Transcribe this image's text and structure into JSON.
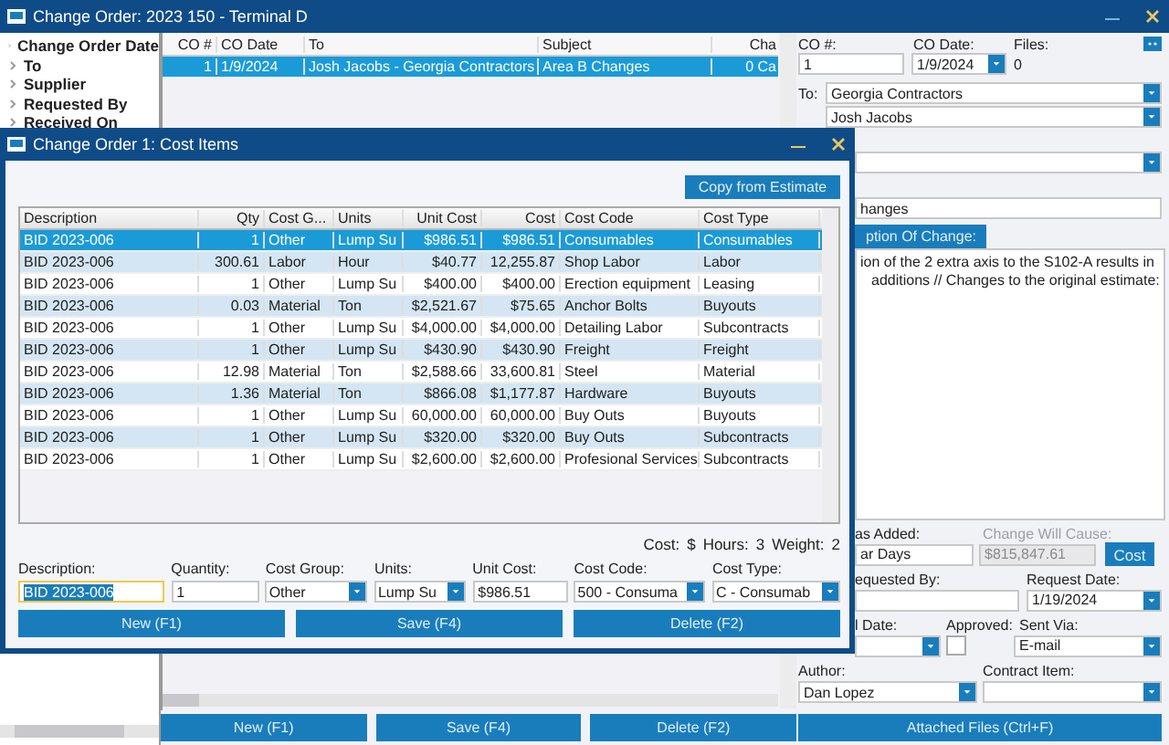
{
  "window": {
    "title": "Change Order: 2023 150 - Terminal D"
  },
  "tree": [
    "Change Order Date",
    "To",
    "Supplier",
    "Requested By",
    "Received On"
  ],
  "grid": {
    "columns": [
      {
        "label": "CO #",
        "numeric": true
      },
      {
        "label": "CO Date",
        "numeric": false
      },
      {
        "label": "To",
        "numeric": false
      },
      {
        "label": "Subject",
        "numeric": false
      },
      {
        "label": "Cha",
        "numeric": true
      }
    ],
    "rows": [
      {
        "selected": true,
        "cells": [
          "1",
          "1/9/2024",
          "Josh Jacobs - Georgia Contractors",
          "Area B Changes",
          "0 Ca"
        ]
      }
    ]
  },
  "buttons": [
    "New (F1)",
    "Save (F4)",
    "Delete (F2)"
  ],
  "form": {
    "co_number": {
      "label": "CO #:",
      "value": "1"
    },
    "co_date": {
      "label": "CO Date:",
      "value": "1/9/2024"
    },
    "files": {
      "label": "Files:",
      "value": "0"
    },
    "to": {
      "label": "To:",
      "company": "Georgia Contractors",
      "contact": "Josh Jacobs"
    },
    "subject_value": "hanges",
    "description_tab": "ption Of Change:",
    "description_lines": [
      "ion of the 2 extra axis to the S102-A results in",
      "additions // Changes to the original estimate:"
    ],
    "days_added": {
      "label": "as Added:",
      "value": "ar Days"
    },
    "change_will_cause": {
      "label": "Change Will Cause:",
      "value": "$815,847.61",
      "disabled": true
    },
    "cost_button": "Cost",
    "requested_by": {
      "label": "equested By:"
    },
    "request_date": {
      "label": "Request Date:",
      "value": "1/19/2024"
    },
    "date_label": "l Date:",
    "approved": {
      "label": "Approved:",
      "checked": false
    },
    "sent_via": {
      "label": "Sent Via:",
      "value": "E-mail"
    },
    "author": {
      "label": "Author:",
      "value": "Dan Lopez"
    },
    "contract_item": {
      "label": "Contract Item:"
    },
    "attached_button": "Attached Files (Ctrl+F)"
  },
  "dialog": {
    "title": "Change Order 1: Cost Items",
    "copy_button": "Copy from Estimate",
    "columns": [
      {
        "label": "Description",
        "numeric": false
      },
      {
        "label": "Qty",
        "numeric": true
      },
      {
        "label": "Cost G...",
        "numeric": false
      },
      {
        "label": "Units",
        "numeric": false
      },
      {
        "label": "Unit Cost",
        "numeric": true
      },
      {
        "label": "Cost",
        "numeric": true
      },
      {
        "label": "Cost Code",
        "numeric": false
      },
      {
        "label": "Cost Type",
        "numeric": false
      }
    ],
    "rows": [
      {
        "selected": true,
        "cells": [
          "BID 2023-006",
          "1",
          "Other",
          "Lump Su",
          "$986.51",
          "$986.51",
          "Consumables",
          "Consumables"
        ]
      },
      {
        "selected": false,
        "cells": [
          "BID 2023-006",
          "300.61",
          "Labor",
          "Hour",
          "$40.77",
          "12,255.87",
          "Shop Labor",
          "Labor"
        ]
      },
      {
        "selected": false,
        "cells": [
          "BID 2023-006",
          "1",
          "Other",
          "Lump Su",
          "$400.00",
          "$400.00",
          "Erection equipment",
          "Leasing"
        ]
      },
      {
        "selected": false,
        "cells": [
          "BID 2023-006",
          "0.03",
          "Material",
          "Ton",
          "$2,521.67",
          "$75.65",
          "Anchor Bolts",
          "Buyouts"
        ]
      },
      {
        "selected": false,
        "cells": [
          "BID 2023-006",
          "1",
          "Other",
          "Lump Su",
          "$4,000.00",
          "$4,000.00",
          "Detailing Labor",
          "Subcontracts"
        ]
      },
      {
        "selected": false,
        "cells": [
          "BID 2023-006",
          "1",
          "Other",
          "Lump Su",
          "$430.90",
          "$430.90",
          "Freight",
          "Freight"
        ]
      },
      {
        "selected": false,
        "cells": [
          "BID 2023-006",
          "12.98",
          "Material",
          "Ton",
          "$2,588.66",
          "33,600.81",
          "Steel",
          "Material"
        ]
      },
      {
        "selected": false,
        "cells": [
          "BID 2023-006",
          "1.36",
          "Material",
          "Ton",
          "$866.08",
          "$1,177.87",
          "Hardware",
          "Buyouts"
        ]
      },
      {
        "selected": false,
        "cells": [
          "BID 2023-006",
          "1",
          "Other",
          "Lump Su",
          "60,000.00",
          "60,000.00",
          "Buy Outs",
          "Buyouts"
        ]
      },
      {
        "selected": false,
        "cells": [
          "BID 2023-006",
          "1",
          "Other",
          "Lump Su",
          "$320.00",
          "$320.00",
          "Buy Outs",
          "Subcontracts"
        ]
      },
      {
        "selected": false,
        "cells": [
          "BID 2023-006",
          "1",
          "Other",
          "Lump Su",
          "$2,600.00",
          "$2,600.00",
          "Profesional Services",
          "Subcontracts"
        ]
      }
    ],
    "totals": [
      {
        "label": "Cost:",
        "value": "$"
      },
      {
        "label": "Hours:",
        "value": "3"
      },
      {
        "label": "Weight:",
        "value": "2"
      }
    ],
    "fields": [
      {
        "label": "Description:",
        "value": "BID 2023-006",
        "kind": "text",
        "focused": true
      },
      {
        "label": "Quantity:",
        "value": "1",
        "kind": "text",
        "focused": false
      },
      {
        "label": "Cost Group:",
        "value": "Other",
        "kind": "combo",
        "focused": false
      },
      {
        "label": "Units:",
        "value": "Lump Su",
        "kind": "combo",
        "focused": false
      },
      {
        "label": "Unit Cost:",
        "value": "$986.51",
        "kind": "text",
        "focused": false
      },
      {
        "label": "Cost Code:",
        "value": "500 - Consuma",
        "kind": "combo",
        "focused": false
      },
      {
        "label": "Cost Type:",
        "value": "C - Consumab",
        "kind": "combo",
        "focused": false
      }
    ],
    "buttons": [
      "New (F1)",
      "Save (F4)",
      "Delete (F2)"
    ]
  }
}
